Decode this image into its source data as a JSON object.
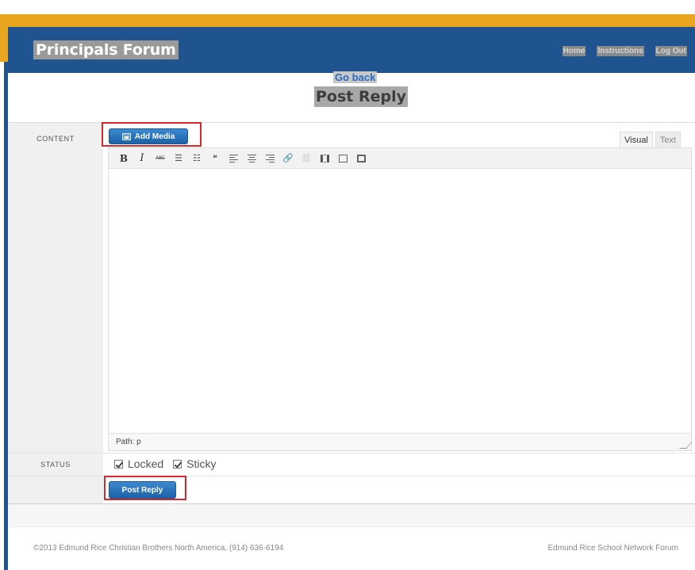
{
  "header": {
    "site_title": "Principals Forum",
    "nav": [
      "Home",
      "Instructions",
      "Log Out"
    ]
  },
  "page": {
    "go_back": "Go back",
    "title": "Post Reply"
  },
  "form": {
    "content_label": "CONTENT",
    "add_media_label": "Add Media",
    "tabs": [
      "Visual",
      "Text"
    ],
    "active_tab": "Visual",
    "toolbar_buttons": [
      "bold",
      "italic",
      "strikethrough",
      "bulleted-list",
      "numbered-list",
      "blockquote",
      "align-left",
      "align-center",
      "align-right",
      "insert-link",
      "remove-link",
      "insert-more",
      "fullscreen",
      "toolbar-toggle"
    ],
    "path_text": "Path: p",
    "status_label": "STATUS",
    "locked_label": "Locked",
    "locked_checked": true,
    "sticky_label": "Sticky",
    "sticky_checked": true,
    "submit_label": "Post Reply"
  },
  "footer": {
    "copyright": "©2013 Edmund Rice Christian Brothers North America, (914) 636-6194",
    "site_name": "Edmund Rice School Network Forum"
  },
  "colors": {
    "header_blue": "#1f5490",
    "accent_gold": "#e8a520",
    "button_blue": "#1c62a8",
    "highlight_red": "#d62a2a"
  }
}
